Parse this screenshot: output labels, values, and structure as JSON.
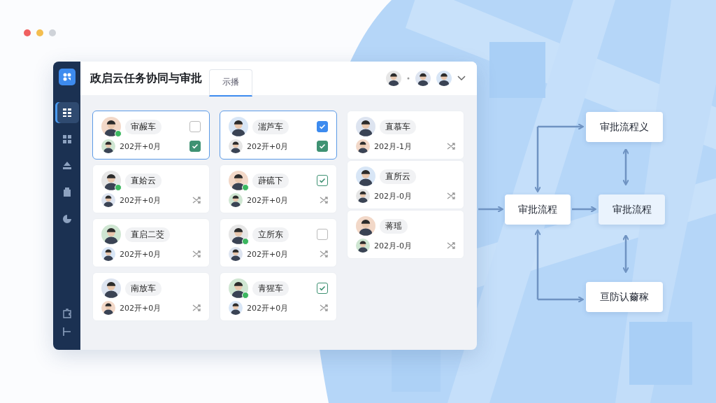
{
  "window": {
    "title": "政启云任务协同与审批",
    "tabs": [
      {
        "label": "示播",
        "selected": true
      }
    ]
  },
  "sidebar": {
    "items": [
      {
        "selected": true
      },
      {
        "selected": false
      },
      {
        "selected": false
      },
      {
        "selected": false
      },
      {
        "selected": false
      }
    ]
  },
  "columns": [
    {
      "cards": [
        {
          "name": "审赧车",
          "online": true,
          "selected": true,
          "top": {
            "kind": "checkbox",
            "checked": false
          },
          "date": "202开+0月",
          "bottom": {
            "kind": "checkbox",
            "checked": true
          }
        },
        {
          "name": "直姶云",
          "online": true,
          "selected": false,
          "top": {
            "kind": "none"
          },
          "date": "202开+0月",
          "bottom": {
            "kind": "icon"
          }
        },
        {
          "name": "直启二茭",
          "online": false,
          "selected": false,
          "top": {
            "kind": "none"
          },
          "date": "202开+0月",
          "bottom": {
            "kind": "icon"
          }
        },
        {
          "name": "南放车",
          "online": false,
          "selected": false,
          "top": {
            "kind": "none"
          },
          "date": "202开+0月",
          "bottom": {
            "kind": "icon"
          }
        }
      ]
    },
    {
      "cards": [
        {
          "name": "湍芦车",
          "online": false,
          "selected": true,
          "top": {
            "kind": "filled-checkbox",
            "checked": true
          },
          "date": "202开+0月",
          "bottom": {
            "kind": "checkbox",
            "checked": true
          }
        },
        {
          "name": "薜硫下",
          "online": true,
          "selected": false,
          "top": {
            "kind": "checkbox",
            "checked": true
          },
          "date": "202开+0月",
          "bottom": {
            "kind": "icon"
          }
        },
        {
          "name": "立所东",
          "online": true,
          "selected": false,
          "top": {
            "kind": "checkbox",
            "checked": false
          },
          "date": "202开+0月",
          "bottom": {
            "kind": "icon"
          }
        },
        {
          "name": "青猩车",
          "online": true,
          "selected": false,
          "top": {
            "kind": "checkbox",
            "checked": true
          },
          "date": "202开+0月",
          "bottom": {
            "kind": "icon"
          }
        }
      ]
    },
    {
      "cards": [
        {
          "name": "直慕车",
          "online": false,
          "selected": false,
          "top": {
            "kind": "none"
          },
          "date": "202月-1月",
          "bottom": {
            "kind": "icon"
          }
        },
        {
          "name": "直所云",
          "online": false,
          "selected": false,
          "top": {
            "kind": "none"
          },
          "date": "202月-0月",
          "bottom": {
            "kind": "icon"
          }
        },
        {
          "name": "蒋瑶",
          "online": false,
          "selected": false,
          "top": {
            "kind": "none"
          },
          "date": "202月-0月",
          "bottom": {
            "kind": "icon"
          }
        }
      ]
    }
  ],
  "diagram": {
    "nodes": [
      {
        "label": "审批流程义"
      },
      {
        "label": "审批流程"
      },
      {
        "label": "审批流程"
      },
      {
        "label": "亘防认薾稼"
      }
    ]
  }
}
